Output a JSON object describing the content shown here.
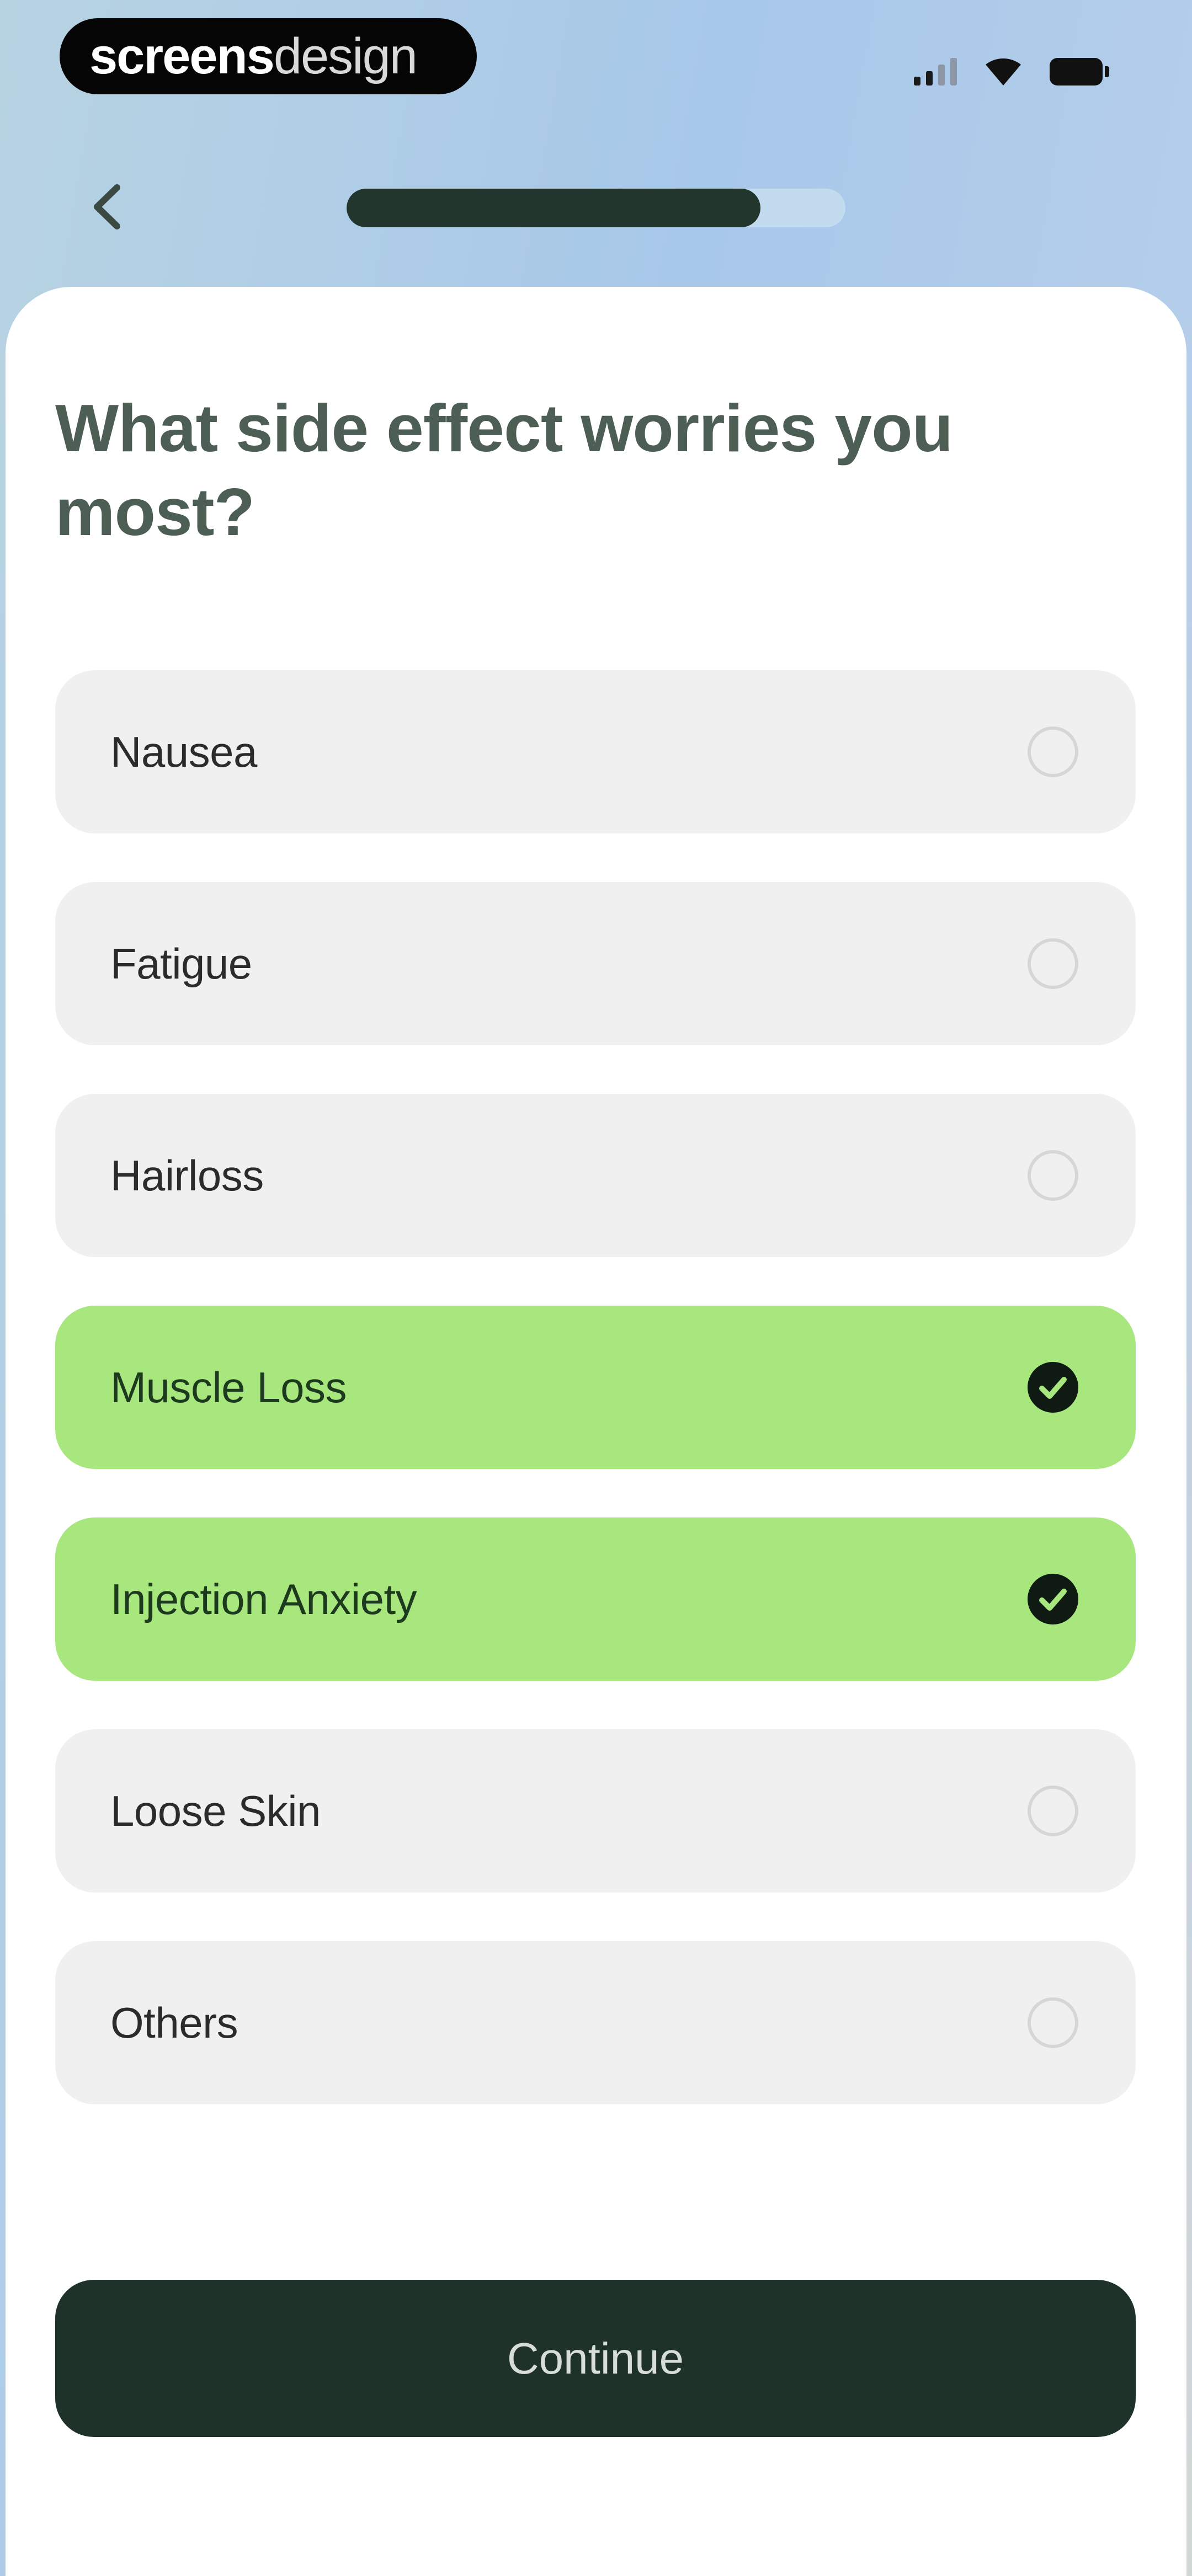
{
  "status_bar": {
    "brand_bold": "screens",
    "brand_light": "design"
  },
  "navigation": {
    "back_icon": "chevron-left-icon",
    "progress_fraction": 0.83
  },
  "question": {
    "title": "What side effect worries you most?"
  },
  "options": [
    {
      "label": "Nausea",
      "selected": false
    },
    {
      "label": "Fatigue",
      "selected": false
    },
    {
      "label": "Hairloss",
      "selected": false
    },
    {
      "label": "Muscle Loss",
      "selected": true
    },
    {
      "label": "Injection Anxiety",
      "selected": true
    },
    {
      "label": "Loose Skin",
      "selected": false
    },
    {
      "label": "Others",
      "selected": false
    }
  ],
  "footer": {
    "continue_label": "Continue"
  },
  "colors": {
    "selected_option": "#a7e77d",
    "unselected_option": "#f0f0f0",
    "primary_dark": "#1f3229",
    "progress_fill": "#22362d"
  }
}
